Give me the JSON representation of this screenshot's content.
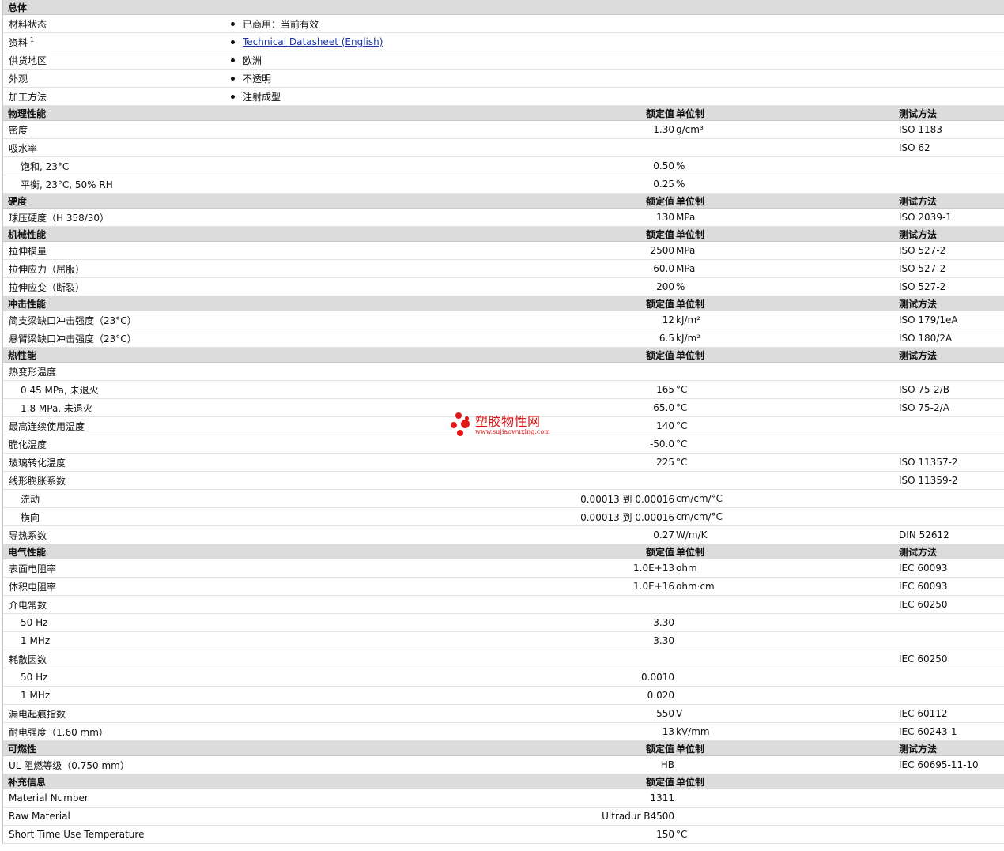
{
  "watermark": {
    "name": "塑胶物性网",
    "url": "www.sujiaowuxing.com"
  },
  "general": {
    "title": "总体",
    "rows": [
      {
        "label": "材料状态",
        "value": "已商用：当前有效",
        "sup": "",
        "link": false
      },
      {
        "label": "资料",
        "value": "Technical Datasheet (English)",
        "sup": "1",
        "link": true
      },
      {
        "label": "供货地区",
        "value": "欧洲",
        "sup": "",
        "link": false
      },
      {
        "label": "外观",
        "value": "不透明",
        "sup": "",
        "link": false
      },
      {
        "label": "加工方法",
        "value": "注射成型",
        "sup": "",
        "link": false
      }
    ]
  },
  "sections": [
    {
      "title": "物理性能",
      "h_val": "额定值",
      "h_unit": "单位制",
      "h_test": "测试方法",
      "rows": [
        {
          "label": "密度",
          "value": "1.30",
          "unit": "g/cm³",
          "test": "ISO 1183",
          "indent": false
        },
        {
          "label": "吸水率",
          "value": "",
          "unit": "",
          "test": "ISO 62",
          "indent": false
        },
        {
          "label": "饱和, 23°C",
          "value": "0.50",
          "unit": "%",
          "test": "",
          "indent": true
        },
        {
          "label": "平衡, 23°C, 50% RH",
          "value": "0.25",
          "unit": "%",
          "test": "",
          "indent": true
        }
      ]
    },
    {
      "title": "硬度",
      "h_val": "额定值",
      "h_unit": "单位制",
      "h_test": "测试方法",
      "rows": [
        {
          "label": "球压硬度（H 358/30）",
          "value": "130",
          "unit": "MPa",
          "test": "ISO 2039-1",
          "indent": false
        }
      ]
    },
    {
      "title": "机械性能",
      "h_val": "额定值",
      "h_unit": "单位制",
      "h_test": "测试方法",
      "rows": [
        {
          "label": "拉伸模量",
          "value": "2500",
          "unit": "MPa",
          "test": "ISO 527-2",
          "indent": false
        },
        {
          "label": "拉伸应力（屈服）",
          "value": "60.0",
          "unit": "MPa",
          "test": "ISO 527-2",
          "indent": false
        },
        {
          "label": "拉伸应变（断裂）",
          "value": "200",
          "unit": "%",
          "test": "ISO 527-2",
          "indent": false
        }
      ]
    },
    {
      "title": "冲击性能",
      "h_val": "额定值",
      "h_unit": "单位制",
      "h_test": "测试方法",
      "rows": [
        {
          "label": "简支梁缺口冲击强度（23°C）",
          "value": "12",
          "unit": "kJ/m²",
          "test": "ISO 179/1eA",
          "indent": false
        },
        {
          "label": "悬臂梁缺口冲击强度（23°C）",
          "value": "6.5",
          "unit": "kJ/m²",
          "test": "ISO 180/2A",
          "indent": false
        }
      ]
    },
    {
      "title": "热性能",
      "h_val": "额定值",
      "h_unit": "单位制",
      "h_test": "测试方法",
      "rows": [
        {
          "label": "热变形温度",
          "value": "",
          "unit": "",
          "test": "",
          "indent": false
        },
        {
          "label": "0.45 MPa, 未退火",
          "value": "165",
          "unit": "°C",
          "test": "ISO 75-2/B",
          "indent": true
        },
        {
          "label": "1.8 MPa, 未退火",
          "value": "65.0",
          "unit": "°C",
          "test": "ISO 75-2/A",
          "indent": true
        },
        {
          "label": "最高连续使用温度",
          "value": "140",
          "unit": "°C",
          "test": "",
          "indent": false
        },
        {
          "label": "脆化温度",
          "value": "-50.0",
          "unit": "°C",
          "test": "",
          "indent": false
        },
        {
          "label": "玻璃转化温度",
          "value": "225",
          "unit": "°C",
          "test": "ISO 11357-2",
          "indent": false
        },
        {
          "label": "线形膨胀系数",
          "value": "",
          "unit": "",
          "test": "ISO 11359-2",
          "indent": false
        },
        {
          "label": "流动",
          "value": "0.00013 到  0.00016",
          "unit": "cm/cm/°C",
          "test": "",
          "indent": true
        },
        {
          "label": "横向",
          "value": "0.00013 到  0.00016",
          "unit": "cm/cm/°C",
          "test": "",
          "indent": true
        },
        {
          "label": "导热系数",
          "value": "0.27",
          "unit": "W/m/K",
          "test": "DIN 52612",
          "indent": false
        }
      ]
    },
    {
      "title": "电气性能",
      "h_val": "额定值",
      "h_unit": "单位制",
      "h_test": "测试方法",
      "rows": [
        {
          "label": "表面电阻率",
          "value": "1.0E+13",
          "unit": "ohm",
          "test": "IEC 60093",
          "indent": false
        },
        {
          "label": "体积电阻率",
          "value": "1.0E+16",
          "unit": "ohm·cm",
          "test": "IEC 60093",
          "indent": false
        },
        {
          "label": "介电常数",
          "value": "",
          "unit": "",
          "test": "IEC 60250",
          "indent": false
        },
        {
          "label": "50 Hz",
          "value": "3.30",
          "unit": "",
          "test": "",
          "indent": true
        },
        {
          "label": "1 MHz",
          "value": "3.30",
          "unit": "",
          "test": "",
          "indent": true
        },
        {
          "label": "耗散因数",
          "value": "",
          "unit": "",
          "test": "IEC 60250",
          "indent": false
        },
        {
          "label": "50 Hz",
          "value": "0.0010",
          "unit": "",
          "test": "",
          "indent": true
        },
        {
          "label": "1 MHz",
          "value": "0.020",
          "unit": "",
          "test": "",
          "indent": true
        },
        {
          "label": "漏电起痕指数",
          "value": "550",
          "unit": "V",
          "test": "IEC 60112",
          "indent": false
        },
        {
          "label": "耐电强度（1.60 mm）",
          "value": "13",
          "unit": "kV/mm",
          "test": "IEC 60243-1",
          "indent": false
        }
      ]
    },
    {
      "title": "可燃性",
      "h_val": "额定值",
      "h_unit": "单位制",
      "h_test": "测试方法",
      "rows": [
        {
          "label": "UL 阻燃等级（0.750 mm）",
          "value": "HB",
          "unit": "",
          "test": "IEC 60695-11-10",
          "indent": false
        }
      ]
    },
    {
      "title": "补充信息",
      "h_val": "额定值",
      "h_unit": "单位制",
      "h_test": "",
      "rows": [
        {
          "label": "Material Number",
          "value": "1311",
          "unit": "",
          "test": "",
          "indent": false
        },
        {
          "label": "Raw Material",
          "value": "Ultradur B4500",
          "unit": "",
          "test": "",
          "indent": false
        },
        {
          "label": "Short Time Use Temperature",
          "value": "150",
          "unit": "°C",
          "test": "",
          "indent": false
        }
      ]
    }
  ]
}
